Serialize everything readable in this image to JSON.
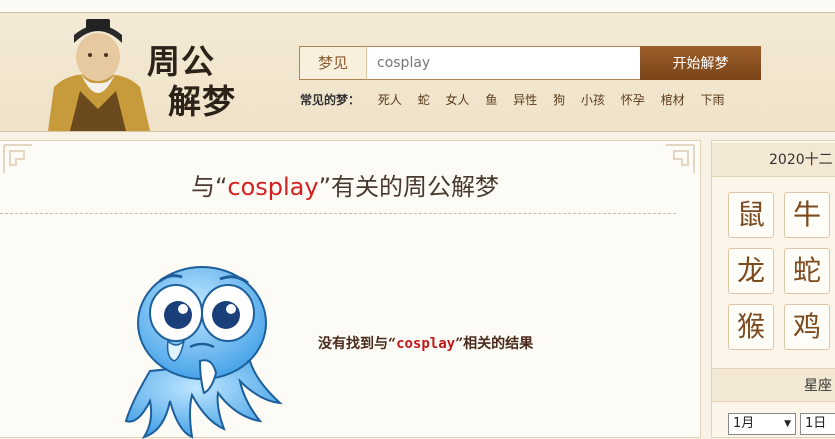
{
  "header": {
    "logo_line1": "周公",
    "logo_line2": "解梦"
  },
  "search": {
    "label": "梦见",
    "value": "cosplay",
    "button": "开始解梦"
  },
  "common_dreams": {
    "label": "常见的梦：",
    "items": [
      "死人",
      "蛇",
      "女人",
      "鱼",
      "异性",
      "狗",
      "小孩",
      "怀孕",
      "棺材",
      "下雨"
    ]
  },
  "result": {
    "title_prefix": "与“",
    "keyword": "cosplay",
    "title_suffix": "”有关的周公解梦",
    "msg_prefix": "没有找到与“",
    "msg_suffix": "”相关的结果"
  },
  "sidebar": {
    "year_header": "2020十二",
    "zodiac": [
      "鼠",
      "牛",
      "龙",
      "蛇",
      "猴",
      "鸡"
    ],
    "star_header": "星座",
    "month_select": "1月",
    "day_select": "1日"
  },
  "colors": {
    "accent_brown": "#7a4519",
    "keyword_red": "#d42020",
    "page_bg": "#f7f1e6"
  }
}
